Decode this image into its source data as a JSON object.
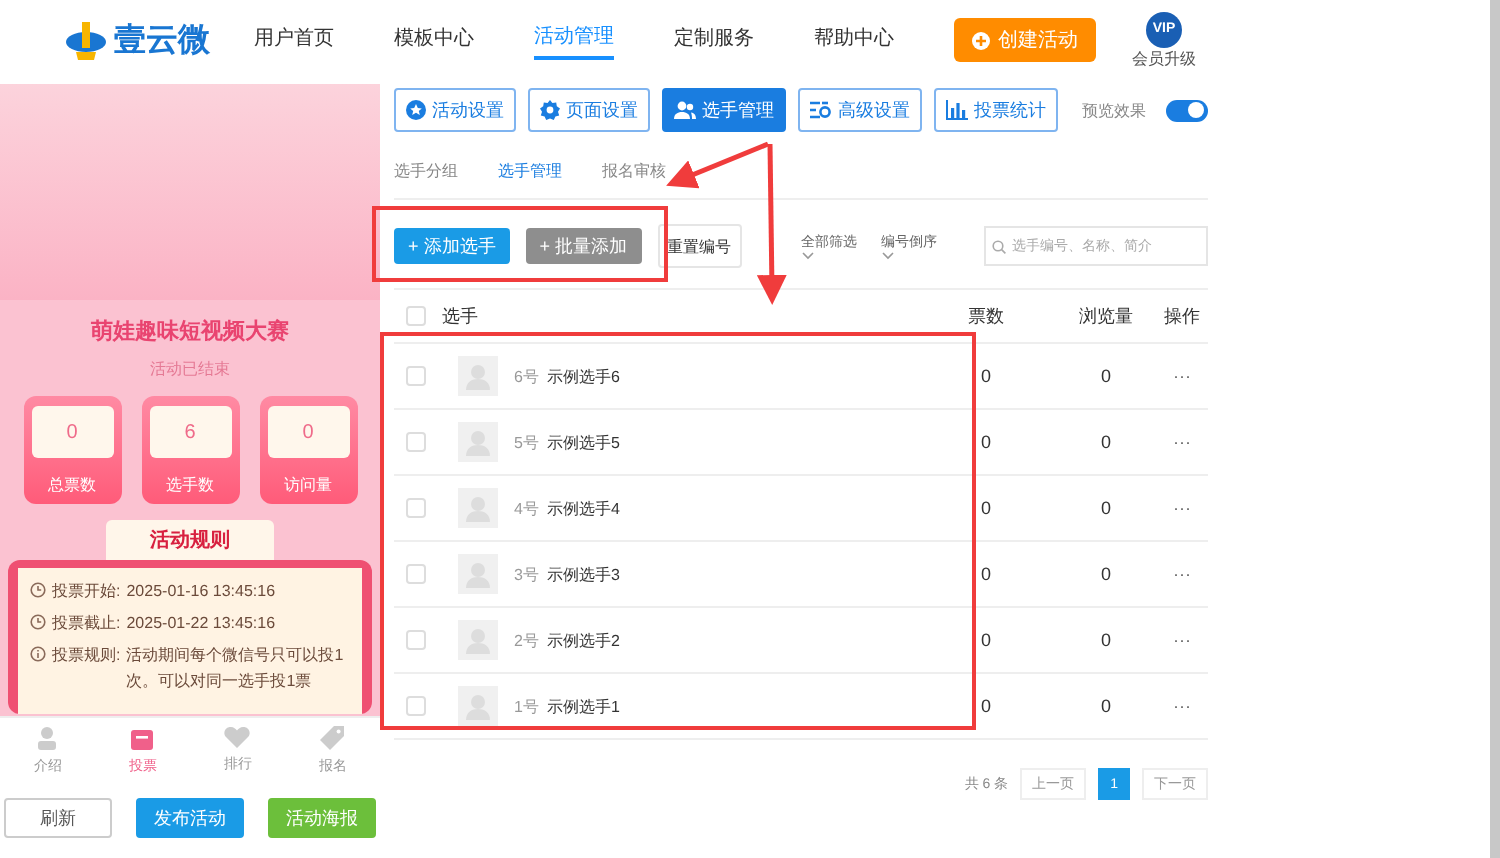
{
  "header": {
    "logo": "壹云微",
    "nav": [
      {
        "label": "用户首页",
        "selected": false
      },
      {
        "label": "模板中心",
        "selected": false
      },
      {
        "label": "活动管理",
        "selected": true
      },
      {
        "label": "定制服务",
        "selected": false
      },
      {
        "label": "帮助中心",
        "selected": false
      }
    ],
    "create_button": "创建活动",
    "vip": {
      "badge": "VIP",
      "label": "会员升级"
    }
  },
  "preview": {
    "title": "萌娃趣味短视频大赛",
    "status": "活动已结束",
    "stats": [
      {
        "value": "0",
        "label": "总票数"
      },
      {
        "value": "6",
        "label": "选手数"
      },
      {
        "value": "0",
        "label": "访问量"
      }
    ],
    "rules": {
      "heading": "活动规则",
      "items": [
        {
          "kind": "clock",
          "label": "投票开始:",
          "value": "2025-01-16 13:45:16"
        },
        {
          "kind": "clock",
          "label": "投票截止:",
          "value": "2025-01-22 13:45:16"
        },
        {
          "kind": "info",
          "label": "投票规则:",
          "value": "活动期间每个微信号只可以投1次。可以对同一选手投1票"
        }
      ]
    },
    "tabbar": [
      {
        "label": "介绍",
        "kind": "person",
        "selected": false
      },
      {
        "label": "投票",
        "kind": "box",
        "selected": true
      },
      {
        "label": "排行",
        "kind": "heart",
        "selected": false
      },
      {
        "label": "报名",
        "kind": "tag",
        "selected": false
      }
    ],
    "buttons": [
      {
        "label": "刷新",
        "kind": "plain"
      },
      {
        "label": "发布活动",
        "kind": "primary"
      },
      {
        "label": "活动海报",
        "kind": "success"
      }
    ]
  },
  "main": {
    "tabs": [
      {
        "label": "活动设置",
        "kind": "star",
        "selected": false
      },
      {
        "label": "页面设置",
        "kind": "gear",
        "selected": false
      },
      {
        "label": "选手管理",
        "kind": "people",
        "selected": true
      },
      {
        "label": "高级设置",
        "kind": "sliders",
        "selected": false
      },
      {
        "label": "投票统计",
        "kind": "chart",
        "selected": false
      }
    ],
    "preview_toggle": {
      "label": "预览效果",
      "on": true
    },
    "subtabs": [
      {
        "label": "选手分组",
        "selected": false
      },
      {
        "label": "选手管理",
        "selected": true
      },
      {
        "label": "报名审核",
        "selected": false
      }
    ],
    "toolbar": {
      "add_button": "+ 添加选手",
      "batch_button": "+ 批量添加",
      "reset_button": "重置编号",
      "filters": [
        "全部筛选",
        "编号倒序"
      ],
      "search_placeholder": "选手编号、名称、简介"
    },
    "table": {
      "header_checked": false,
      "columns": [
        "选手",
        "票数",
        "浏览量",
        "操作"
      ],
      "rows": [
        {
          "number": "6号",
          "name": "示例选手6",
          "votes": "0",
          "views": "0",
          "action": "···",
          "checked": false
        },
        {
          "number": "5号",
          "name": "示例选手5",
          "votes": "0",
          "views": "0",
          "action": "···",
          "checked": false
        },
        {
          "number": "4号",
          "name": "示例选手4",
          "votes": "0",
          "views": "0",
          "action": "···",
          "checked": false
        },
        {
          "number": "3号",
          "name": "示例选手3",
          "votes": "0",
          "views": "0",
          "action": "···",
          "checked": false
        },
        {
          "number": "2号",
          "name": "示例选手2",
          "votes": "0",
          "views": "0",
          "action": "···",
          "checked": false
        },
        {
          "number": "1号",
          "name": "示例选手1",
          "votes": "0",
          "views": "0",
          "action": "···",
          "checked": false
        }
      ]
    },
    "pagination": {
      "total": "共 6 条",
      "prev": "上一页",
      "pages": [
        {
          "label": "1",
          "selected": true
        }
      ],
      "next": "下一页"
    }
  }
}
